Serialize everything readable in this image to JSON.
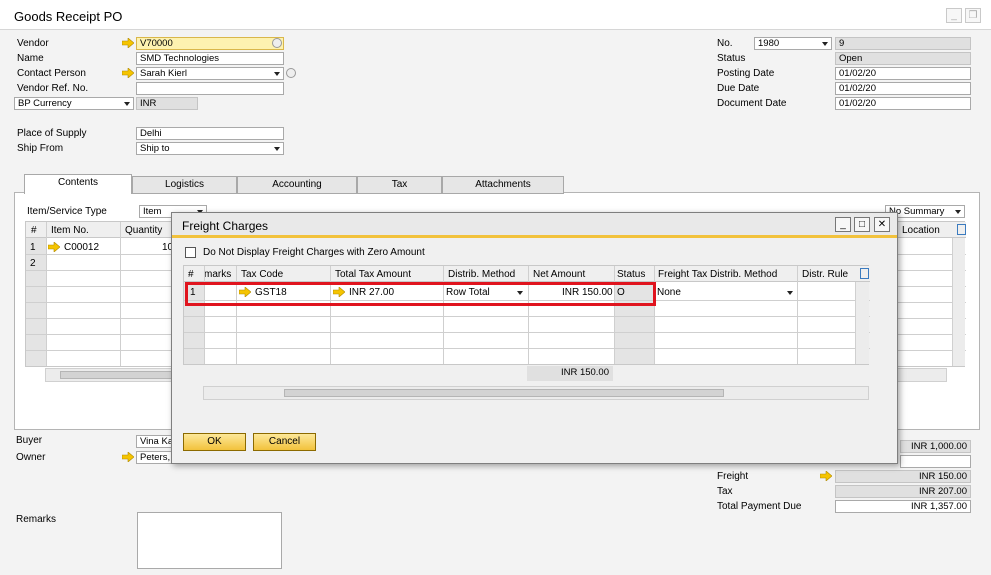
{
  "window": {
    "title": "Goods Receipt PO"
  },
  "header_left": {
    "vendor_label": "Vendor",
    "vendor_value": "V70000",
    "name_label": "Name",
    "name_value": "SMD Technologies",
    "contact_label": "Contact Person",
    "contact_value": "Sarah Kierl",
    "vendor_ref_label": "Vendor Ref. No.",
    "vendor_ref_value": "",
    "bp_currency_label": "BP Currency",
    "bp_currency_value": "INR",
    "place_supply_label": "Place of Supply",
    "place_supply_value": "Delhi",
    "ship_from_label": "Ship From",
    "ship_from_value": "Ship to"
  },
  "header_right": {
    "no_label": "No.",
    "series_value": "1980",
    "no_value": "9",
    "status_label": "Status",
    "status_value": "Open",
    "posting_date_label": "Posting Date",
    "posting_date_value": "01/02/20",
    "due_date_label": "Due Date",
    "due_date_value": "01/02/20",
    "document_date_label": "Document Date",
    "document_date_value": "01/02/20"
  },
  "tabs": [
    {
      "label": "Contents"
    },
    {
      "label": "Logistics"
    },
    {
      "label": "Accounting"
    },
    {
      "label": "Tax"
    },
    {
      "label": "Attachments"
    }
  ],
  "contents": {
    "item_type_label": "Item/Service Type",
    "item_type_value": "Item",
    "summary_value": "No Summary",
    "columns": {
      "num": "#",
      "item_no": "Item No.",
      "quantity": "Quantity",
      "location": "Location"
    },
    "rows": [
      {
        "num": "1",
        "item_no": "C00012",
        "quantity": "10"
      },
      {
        "num": "2",
        "item_no": "",
        "quantity": ""
      }
    ]
  },
  "footer_left": {
    "buyer_label": "Buyer",
    "buyer_value": "Vina Ka",
    "owner_label": "Owner",
    "owner_value": "Peters,",
    "remarks_label": "Remarks"
  },
  "totals": {
    "before_discount_value": "INR 1,000.00",
    "freight_label": "Freight",
    "freight_value": "INR 150.00",
    "tax_label": "Tax",
    "tax_value": "INR 207.00",
    "total_label": "Total Payment Due",
    "total_value": "INR 1,357.00"
  },
  "dialog": {
    "title": "Freight Charges",
    "checkbox_label": "Do Not Display Freight Charges with Zero Amount",
    "columns": {
      "num": "#",
      "remarks": "marks",
      "tax_code": "Tax Code",
      "total_tax": "Total Tax Amount",
      "distrib": "Distrib. Method",
      "net": "Net Amount",
      "status": "Status",
      "freight_tax": "Freight Tax Distrib. Method",
      "distr_rule": "Distr. Rule"
    },
    "row": {
      "num": "1",
      "tax_code": "GST18",
      "total_tax": "INR 27.00",
      "distrib": "Row Total",
      "net": "INR 150.00",
      "status": "O",
      "freight_tax": "None"
    },
    "net_total": "INR 150.00",
    "ok_label": "OK",
    "cancel_label": "Cancel"
  },
  "colors": {
    "highlight": "#e0141e",
    "accent": "#f2c23c"
  }
}
